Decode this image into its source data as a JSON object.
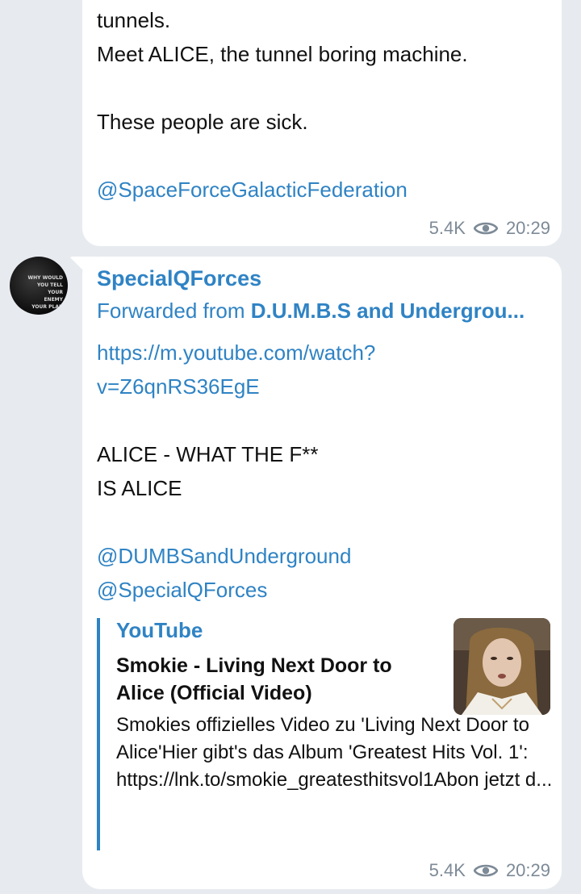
{
  "messages": [
    {
      "lines": [
        "tunnels.",
        "Meet ALICE, the tunnel boring machine.",
        "",
        "These people are sick.",
        "",
        "@SpaceForceGalacticFederation"
      ],
      "views": "5.4K",
      "time": "20:29"
    },
    {
      "sender": "SpecialQForces",
      "forwarded_prefix": "Forwarded from ",
      "forwarded_from": "D.U.M.B.S and Undergrou...",
      "link_line1": "https://m.youtube.com/watch?",
      "link_line2": "v=Z6qnRS36EgE",
      "text_line1": "ALICE - WHAT THE F**",
      "text_line2": "IS ALICE",
      "mention1": "@DUMBSandUnderground",
      "mention2": "@SpecialQForces",
      "preview": {
        "site": "YouTube",
        "title": "Smokie - Living Next Door to Alice (Official Video)",
        "description": "Smokies offizielles Video zu 'Living Next Door to Alice'Hier gibt's das Album 'Greatest Hits Vol. 1': https://lnk.to/smokie_greatesthitsvol1Abon jetzt d..."
      },
      "views": "5.4K",
      "time": "20:29"
    }
  ],
  "avatar_text": "WHY WOULD YOU TELL YOUR ENEMY YOUR PLAN",
  "colors": {
    "accent": "#2f83c4",
    "background": "#e7ebf0",
    "bubble": "#ffffff",
    "meta": "#7d8a97"
  }
}
